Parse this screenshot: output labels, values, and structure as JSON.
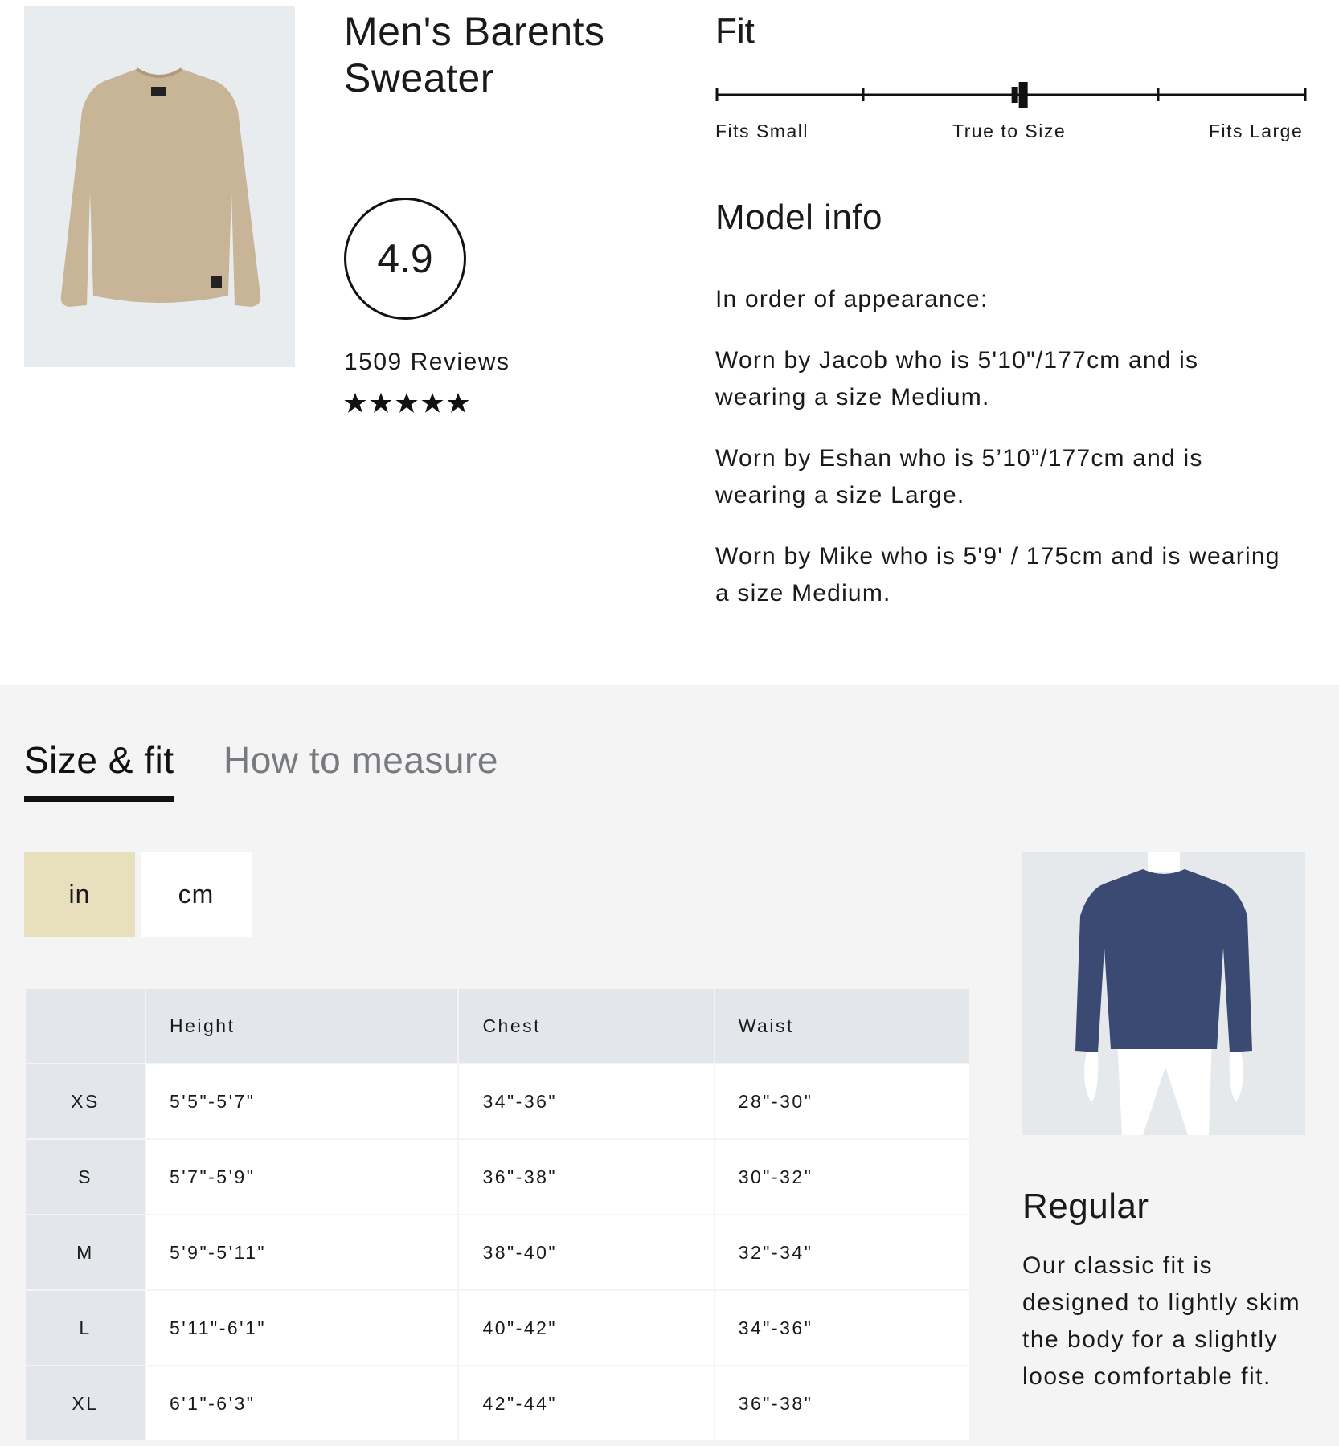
{
  "product": {
    "title": "Men's Barents Sweater",
    "rating": "4.9",
    "review_count": "1509 Reviews",
    "stars": 5,
    "image_icon": "sweater-icon",
    "sweater_color": "#c8b496"
  },
  "fit": {
    "heading": "Fit",
    "scale_labels": [
      "Fits Small",
      "True to Size",
      "Fits Large"
    ],
    "marker_value": 0.52
  },
  "model_info": {
    "heading": "Model info",
    "lines": [
      "In order of appearance:",
      "Worn by Jacob who is 5'10\"/177cm and is wearing a size Medium.",
      "Worn by Eshan who is 5’10”/177cm and is wearing a size Large.",
      "Worn by Mike who is 5'9' / 175cm and is wearing a size Medium."
    ]
  },
  "size_section": {
    "tabs": [
      {
        "label": "Size & fit",
        "active": true
      },
      {
        "label": "How to measure",
        "active": false
      }
    ],
    "units": [
      {
        "label": "in",
        "selected": true
      },
      {
        "label": "cm",
        "selected": false
      }
    ],
    "table": {
      "headers": [
        "",
        "Height",
        "Chest",
        "Waist"
      ],
      "rows": [
        {
          "size": "XS",
          "height": "5'5\"-5'7\"",
          "chest": "34\"-36\"",
          "waist": "28\"-30\""
        },
        {
          "size": "S",
          "height": "5'7\"-5'9\"",
          "chest": "36\"-38\"",
          "waist": "30\"-32\""
        },
        {
          "size": "M",
          "height": "5'9\"-5'11\"",
          "chest": "38\"-40\"",
          "waist": "32\"-34\""
        },
        {
          "size": "L",
          "height": "5'11\"-6'1\"",
          "chest": "40\"-42\"",
          "waist": "34\"-36\""
        },
        {
          "size": "XL",
          "height": "6'1\"-6'3\"",
          "chest": "42\"-44\"",
          "waist": "36\"-38\""
        }
      ]
    },
    "fit_type": "Regular",
    "fit_description": "Our classic fit is designed to lightly skim the body for a slightly loose comfortable fit.",
    "illustration_icon": "fit-figure-icon"
  },
  "colors": {
    "unit_selected_bg": "#e8dfbd",
    "unit_bg": "#ffffff",
    "figure_sweater": "#3a4a72",
    "tab_inactive": "#777b80"
  }
}
